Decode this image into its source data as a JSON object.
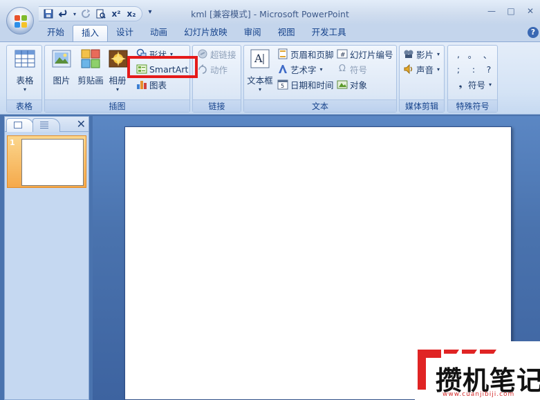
{
  "window": {
    "title": "kml [兼容模式] - Microsoft PowerPoint",
    "minimize_glyph": "▭",
    "maximize_glyph": "□",
    "close_glyph": "✕"
  },
  "quick_access": {
    "save_icon": "save-icon",
    "undo_icon": "undo-icon",
    "redo_icon": "redo-icon",
    "print_preview_icon": "print-preview-icon",
    "superscript_label": "x²",
    "subscript_label": "x₂",
    "more_glyph": "▾"
  },
  "tabs": [
    {
      "label": "开始",
      "active": false
    },
    {
      "label": "插入",
      "active": true
    },
    {
      "label": "设计",
      "active": false
    },
    {
      "label": "动画",
      "active": false
    },
    {
      "label": "幻灯片放映",
      "active": false
    },
    {
      "label": "审阅",
      "active": false
    },
    {
      "label": "视图",
      "active": false
    },
    {
      "label": "开发工具",
      "active": false
    }
  ],
  "help_label": "?",
  "ribbon": {
    "table": {
      "button": "表格",
      "group": "表格"
    },
    "illustrations": {
      "picture": "图片",
      "clipart": "剪贴画",
      "album": "相册",
      "shapes": "形状",
      "smartart": "SmartArt",
      "chart": "图表",
      "group": "插图"
    },
    "links": {
      "hyperlink": "超链接",
      "action": "动作",
      "group": "链接"
    },
    "text": {
      "textbox": "文本框",
      "header_footer": "页眉和页脚",
      "wordart": "艺术字",
      "datetime": "日期和时间",
      "slide_number": "幻灯片编号",
      "symbol": "符号",
      "object": "对象",
      "group": "文本"
    },
    "media": {
      "movie": "影片",
      "sound": "声音",
      "group": "媒体剪辑"
    },
    "special_symbols": {
      "chars": [
        ",",
        "。",
        "、",
        ";",
        ":",
        "?"
      ],
      "symbol": "符号",
      "group": "特殊符号"
    }
  },
  "slides_pane": {
    "thumbnail_number": "1",
    "close_glyph": "✕"
  },
  "watermark": {
    "text": "攒机笔记",
    "url": "www.cuanjibiji.com"
  },
  "colors": {
    "highlight": "#e51a1a",
    "accent": "#15428b",
    "slide_bg": "#4a73ae"
  }
}
